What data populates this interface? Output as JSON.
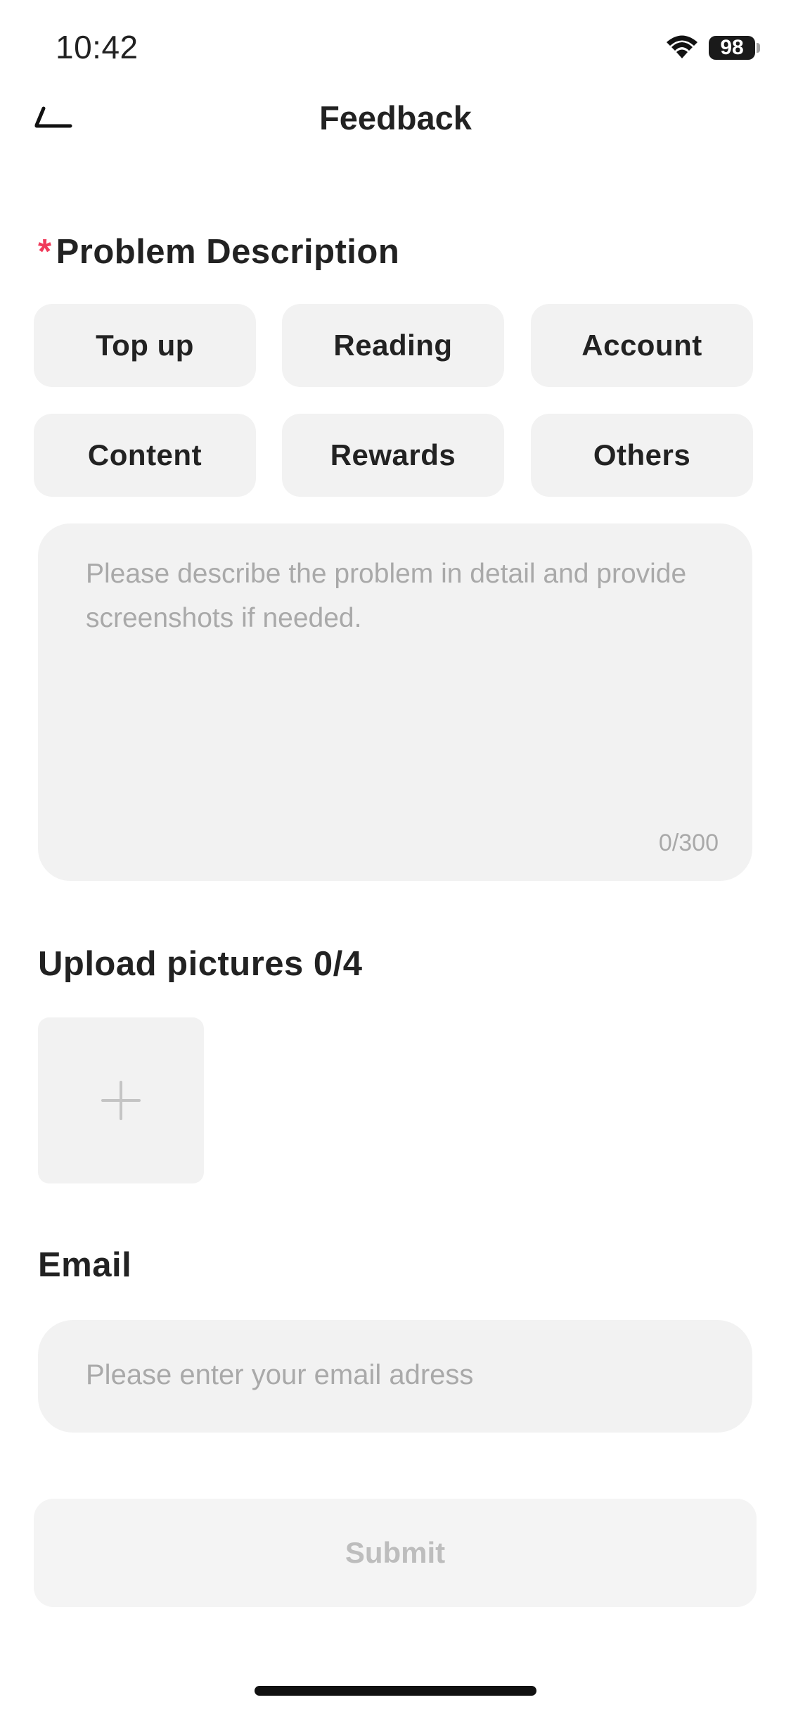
{
  "status_bar": {
    "time": "10:42",
    "battery": "98",
    "icons": [
      "wifi-icon",
      "battery-icon"
    ]
  },
  "nav": {
    "title": "Feedback",
    "back_icon": "back-arrow-icon"
  },
  "problem": {
    "required_mark": "*",
    "title": "Problem Description",
    "categories": [
      "Top up",
      "Reading",
      "Account",
      "Content",
      "Rewards",
      "Others"
    ],
    "description_placeholder": "Please describe the problem in detail and provide screenshots if needed.",
    "counter": "0/300"
  },
  "upload": {
    "title": "Upload pictures 0/4",
    "add_icon": "plus-icon"
  },
  "email": {
    "title": "Email",
    "placeholder": "Please enter your email adress"
  },
  "submit": {
    "label": "Submit"
  },
  "colors": {
    "accent_required": "#f03a5a",
    "field_background": "#f2f2f2",
    "placeholder_text": "#a9a9a9",
    "disabled_text": "#bdbdbd"
  }
}
